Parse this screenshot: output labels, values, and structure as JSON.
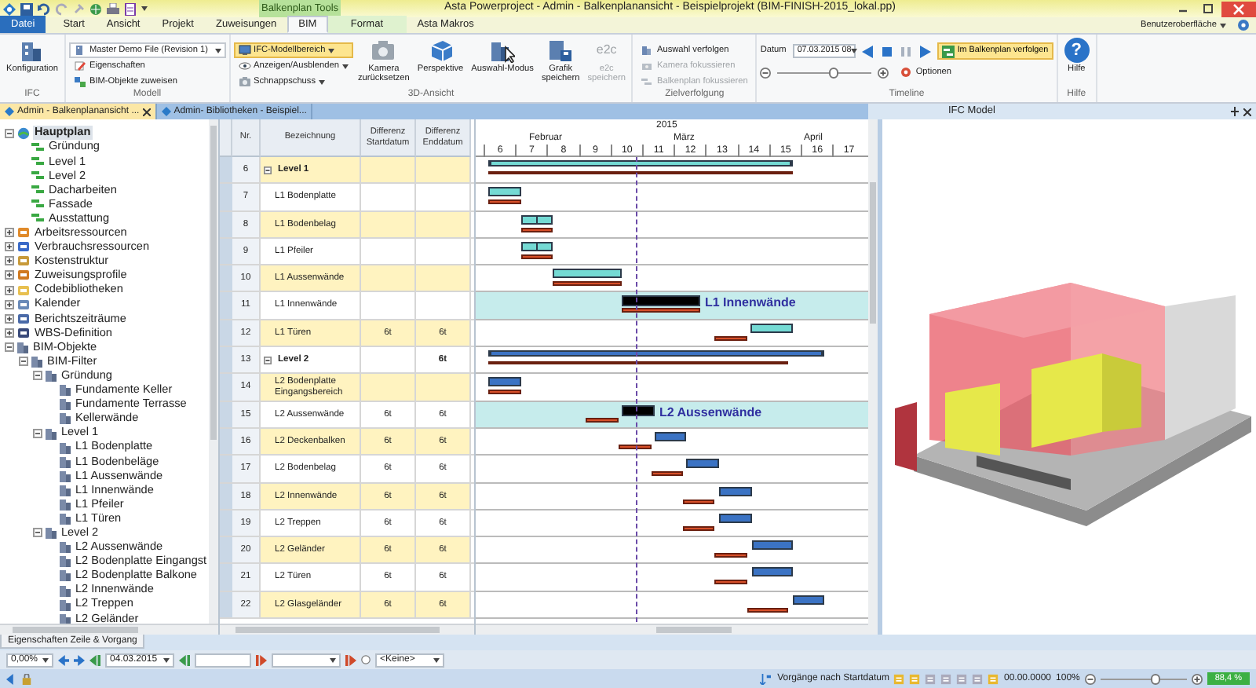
{
  "window": {
    "title": "Asta Powerproject - Admin - Balkenplanansicht - Beispielprojekt (BIM-FINISH-2015_lokal.pp)",
    "context_header": "Balkenplan Tools"
  },
  "ribbon_tabs": [
    {
      "label": "Datei",
      "kind": "file",
      "selected": false
    },
    {
      "label": "Start",
      "kind": "tab",
      "selected": false
    },
    {
      "label": "Ansicht",
      "kind": "tab",
      "selected": false
    },
    {
      "label": "Projekt",
      "kind": "tab",
      "selected": false
    },
    {
      "label": "Zuweisungen",
      "kind": "tab",
      "selected": false
    },
    {
      "label": "BIM",
      "kind": "tab",
      "selected": true
    },
    {
      "label": "Format",
      "kind": "context",
      "selected": false
    },
    {
      "label": "Asta Makros",
      "kind": "tab",
      "selected": false
    }
  ],
  "ui_menu": "Benutzeroberfläche",
  "ribbon_groups": [
    {
      "label": "IFC",
      "kind": "buttons",
      "items": [
        {
          "kind": "large",
          "label": "Konfiguration"
        }
      ]
    },
    {
      "label": "Modell",
      "kind": "buttons",
      "items": [
        {
          "kind": "combo",
          "label": "Master Demo File (Revision 1)"
        },
        {
          "kind": "small",
          "label": "Eigenschaften"
        },
        {
          "kind": "small",
          "label": "BIM-Objekte zuweisen"
        }
      ]
    },
    {
      "label": "3D-Ansicht",
      "kind": "buttons",
      "items": [
        {
          "kind": "split",
          "label": "IFC-Modellbereich",
          "selected": true,
          "disabled": false
        },
        {
          "kind": "menu",
          "label": "Anzeigen/Ausblenden",
          "selected": false,
          "disabled": false
        },
        {
          "kind": "menu",
          "label": "Schnappschuss",
          "selected": false,
          "disabled": false
        },
        {
          "kind": "large",
          "label": "Kamera zurücksetzen",
          "selected": false,
          "disabled": false
        },
        {
          "kind": "large",
          "label": "Perspektive",
          "selected": false,
          "disabled": false
        },
        {
          "kind": "large",
          "label": "Auswahl-Modus",
          "selected": false,
          "disabled": false
        },
        {
          "kind": "large",
          "label": "Grafik speichern",
          "selected": false,
          "disabled": false
        },
        {
          "kind": "large",
          "label": "e2c speichern",
          "icon_text": "e2c",
          "selected": false,
          "disabled": true
        }
      ]
    },
    {
      "label": "Zielverfolgung",
      "kind": "buttons",
      "items": [
        {
          "kind": "small",
          "label": "Auswahl verfolgen",
          "disabled": false
        },
        {
          "kind": "small",
          "label": "Kamera fokussieren",
          "disabled": true
        },
        {
          "kind": "small",
          "label": "Balkenplan fokussieren",
          "disabled": true
        }
      ]
    },
    {
      "label": "Timeline",
      "kind": "timeline",
      "date_label": "Datum",
      "date_value": "07.03.2015 08",
      "follow_button": {
        "label": "Im Balkenplan verfolgen",
        "selected": true
      },
      "slider": {
        "level": 0.6
      },
      "options_label": "Optionen"
    },
    {
      "label": "Hilfe",
      "kind": "buttons",
      "items": [
        {
          "kind": "large",
          "label": "Hilfe",
          "icon_text": "?"
        }
      ]
    }
  ],
  "document_tabs": [
    {
      "label": "Admin - Balkenplanansicht ...",
      "selected": true
    },
    {
      "label": "Admin- Bibliotheken - Beispiel...",
      "selected": false
    }
  ],
  "side_panel": {
    "title": "IFC Model"
  },
  "tree": [
    {
      "label": "Hauptplan",
      "kind": "plan",
      "selected": true,
      "expanded": true,
      "children": [
        {
          "label": "Gründung",
          "kind": "task",
          "selected": false
        },
        {
          "label": "Level 1",
          "kind": "task",
          "selected": false
        },
        {
          "label": "Level 2",
          "kind": "task",
          "selected": false
        },
        {
          "label": "Dacharbeiten",
          "kind": "task",
          "selected": false
        },
        {
          "label": "Fassade",
          "kind": "task",
          "selected": false
        },
        {
          "label": "Ausstattung",
          "kind": "task",
          "selected": false
        }
      ]
    },
    {
      "label": "Arbeitsressourcen",
      "kind": "person",
      "selected": false,
      "expanded": false
    },
    {
      "label": "Verbrauchsressourcen",
      "kind": "stack",
      "selected": false,
      "expanded": false
    },
    {
      "label": "Kostenstruktur",
      "kind": "coins",
      "selected": false,
      "expanded": false
    },
    {
      "label": "Zuweisungsprofile",
      "kind": "profile",
      "selected": false,
      "expanded": false
    },
    {
      "label": "Codebibliotheken",
      "kind": "folder",
      "selected": false,
      "expanded": false
    },
    {
      "label": "Kalender",
      "kind": "calendar",
      "selected": false,
      "expanded": false
    },
    {
      "label": "Berichtszeiträume",
      "kind": "report",
      "selected": false,
      "expanded": false
    },
    {
      "label": "WBS-Definition",
      "kind": "wbs",
      "selected": false,
      "expanded": false
    },
    {
      "label": "BIM-Objekte",
      "kind": "bim",
      "selected": false,
      "expanded": true,
      "children": [
        {
          "label": "BIM-Filter",
          "kind": "bim",
          "selected": false,
          "expanded": true,
          "children": [
            {
              "label": "Gründung",
              "kind": "bim",
              "selected": false,
              "expanded": true,
              "children": [
                {
                  "label": "Fundamente Keller",
                  "kind": "bim",
                  "selected": false
                },
                {
                  "label": "Fundamente Terrasse",
                  "kind": "bim",
                  "selected": false
                },
                {
                  "label": "Kellerwände",
                  "kind": "bim",
                  "selected": false
                }
              ]
            },
            {
              "label": "Level 1",
              "kind": "bim",
              "selected": false,
              "expanded": true,
              "children": [
                {
                  "label": "L1 Bodenplatte",
                  "kind": "bim",
                  "selected": false
                },
                {
                  "label": "L1 Bodenbeläge",
                  "kind": "bim",
                  "selected": false
                },
                {
                  "label": "L1 Aussenwände",
                  "kind": "bim",
                  "selected": false
                },
                {
                  "label": "L1 Innenwände",
                  "kind": "bim",
                  "selected": false
                },
                {
                  "label": "L1 Pfeiler",
                  "kind": "bim",
                  "selected": false
                },
                {
                  "label": "L1 Türen",
                  "kind": "bim",
                  "selected": false
                }
              ]
            },
            {
              "label": "Level 2",
              "kind": "bim",
              "selected": false,
              "expanded": true,
              "children": [
                {
                  "label": "L2 Aussenwände",
                  "kind": "bim",
                  "selected": false
                },
                {
                  "label": "L2 Bodenplatte Eingangst",
                  "kind": "bim",
                  "selected": false
                },
                {
                  "label": "L2 Bodenplatte Balkone",
                  "kind": "bim",
                  "selected": false
                },
                {
                  "label": "L2 Innenwände",
                  "kind": "bim",
                  "selected": false
                },
                {
                  "label": "L2 Treppen",
                  "kind": "bim",
                  "selected": false
                },
                {
                  "label": "L2 Geländer",
                  "kind": "bim",
                  "selected": false
                }
              ]
            }
          ]
        }
      ]
    }
  ],
  "table": {
    "columns": [
      "Nr.",
      "Bezeichnung",
      "Differenz Startdatum",
      "Differenz Enddatum"
    ],
    "rows": [
      {
        "nr": "6",
        "name": "Level 1",
        "kind": "group",
        "expanded": true,
        "diff_start": "",
        "diff_end": "",
        "highlighted": false
      },
      {
        "nr": "7",
        "name": "L1 Bodenplatte",
        "kind": "task",
        "diff_start": "",
        "diff_end": "",
        "highlighted": false
      },
      {
        "nr": "8",
        "name": "L1 Bodenbelag",
        "kind": "task",
        "diff_start": "",
        "diff_end": "",
        "highlighted": false
      },
      {
        "nr": "9",
        "name": "L1 Pfeiler",
        "kind": "task",
        "diff_start": "",
        "diff_end": "",
        "highlighted": false
      },
      {
        "nr": "10",
        "name": "L1 Aussenwände",
        "kind": "task",
        "diff_start": "",
        "diff_end": "",
        "highlighted": false
      },
      {
        "nr": "11",
        "name": "L1 Innenwände",
        "kind": "task",
        "diff_start": "",
        "diff_end": "",
        "highlighted": true,
        "bar_label": "L1 Innenwände"
      },
      {
        "nr": "12",
        "name": "L1 Türen",
        "kind": "task",
        "diff_start": "6t",
        "diff_end": "6t",
        "highlighted": false
      },
      {
        "nr": "13",
        "name": "Level 2",
        "kind": "group",
        "expanded": true,
        "diff_start": "",
        "diff_end": "6t",
        "highlighted": false
      },
      {
        "nr": "14",
        "name": "L2 Bodenplatte Eingangsbereich",
        "kind": "task",
        "diff_start": "",
        "diff_end": "",
        "highlighted": false
      },
      {
        "nr": "15",
        "name": "L2 Aussenwände",
        "kind": "task",
        "diff_start": "6t",
        "diff_end": "6t",
        "highlighted": true,
        "bar_label": "L2 Aussenwände"
      },
      {
        "nr": "16",
        "name": "L2 Deckenbalken",
        "kind": "task",
        "diff_start": "6t",
        "diff_end": "6t",
        "highlighted": false
      },
      {
        "nr": "17",
        "name": "L2 Bodenbelag",
        "kind": "task",
        "diff_start": "6t",
        "diff_end": "6t",
        "highlighted": false
      },
      {
        "nr": "18",
        "name": "L2 Innenwände",
        "kind": "task",
        "diff_start": "6t",
        "diff_end": "6t",
        "highlighted": false
      },
      {
        "nr": "19",
        "name": "L2 Treppen",
        "kind": "task",
        "diff_start": "6t",
        "diff_end": "6t",
        "highlighted": false
      },
      {
        "nr": "20",
        "name": "L2 Geländer",
        "kind": "task",
        "diff_start": "6t",
        "diff_end": "6t",
        "highlighted": false
      },
      {
        "nr": "21",
        "name": "L2 Türen",
        "kind": "task",
        "diff_start": "6t",
        "diff_end": "6t",
        "highlighted": false
      },
      {
        "nr": "22",
        "name": "L2 Glasgeländer",
        "kind": "task",
        "diff_start": "6t",
        "diff_end": "6t",
        "highlighted": false
      }
    ]
  },
  "timescale": {
    "year": "2015",
    "months": [
      "Februar",
      "März",
      "April"
    ],
    "weeks": [
      "6",
      "7",
      "8",
      "9",
      "10",
      "11",
      "12",
      "13",
      "14",
      "15",
      "16",
      "17"
    ]
  },
  "properties_tab": {
    "label": "Eigenschaften Zeile & Vorgang"
  },
  "toolbar": {
    "percent": "0,00%",
    "start_date": "04.03.2015",
    "radio_label": "<Keine>",
    "radio_checked": false
  },
  "status_bar": {
    "sort_label": "Vorgänge nach Startdatum",
    "date": "00.00.0000",
    "zoom_percent": "100%",
    "zoom": {
      "level": 0.63
    },
    "progress_label": "88,4 %"
  }
}
